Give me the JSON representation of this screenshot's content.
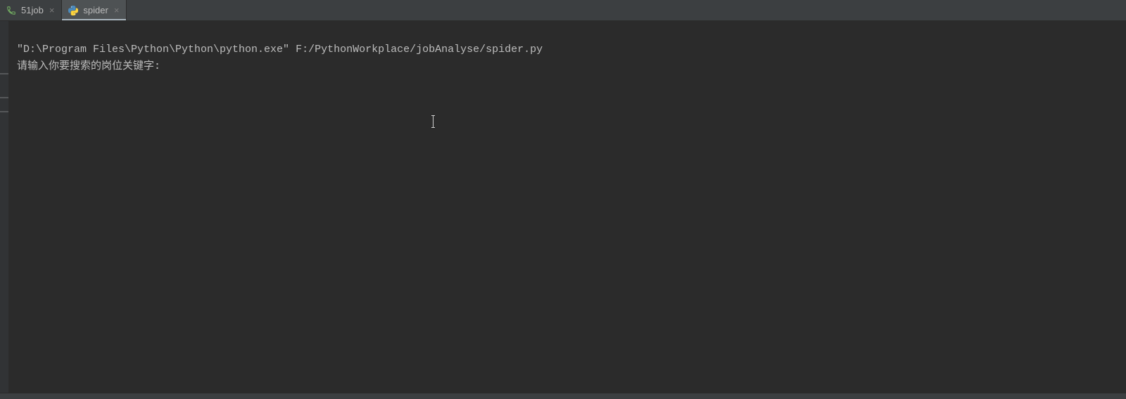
{
  "tabs": [
    {
      "label": "51job",
      "icon": "phone-icon",
      "active": false
    },
    {
      "label": "spider",
      "icon": "python-icon",
      "active": true
    }
  ],
  "console": {
    "line1": "\"D:\\Program Files\\Python\\Python\\python.exe\" F:/PythonWorkplace/jobAnalyse/spider.py",
    "line2": "请输入你要搜索的岗位关键字:"
  }
}
